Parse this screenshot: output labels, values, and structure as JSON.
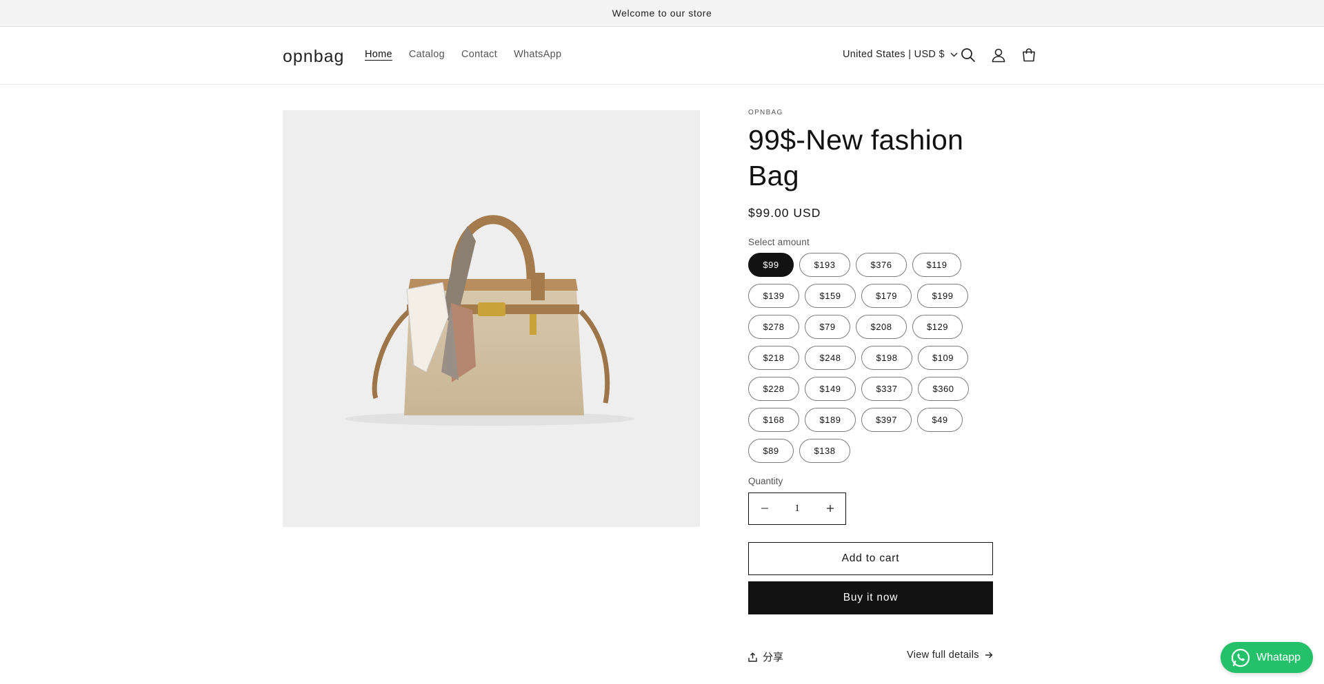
{
  "announcement": "Welcome to our store",
  "header": {
    "logo": "opnbag",
    "nav": [
      "Home",
      "Catalog",
      "Contact",
      "WhatsApp"
    ],
    "locale": "United States | USD $"
  },
  "product": {
    "vendor": "OPNBAG",
    "title": "99$-New fashion Bag",
    "price": "$99.00 USD",
    "select_label": "Select amount",
    "amounts": [
      "$99",
      "$193",
      "$376",
      "$119",
      "$139",
      "$159",
      "$179",
      "$199",
      "$278",
      "$79",
      "$208",
      "$129",
      "$218",
      "$248",
      "$198",
      "$109",
      "$228",
      "$149",
      "$337",
      "$360",
      "$168",
      "$189",
      "$397",
      "$49",
      "$89",
      "$138"
    ],
    "selected_amount": "$99",
    "quantity_label": "Quantity",
    "quantity": "1",
    "add_to_cart": "Add to cart",
    "buy_now": "Buy it now",
    "share": "分享",
    "view_details": "View full details"
  },
  "whatsapp_chat": "Whatapp",
  "colors": {
    "accent": "#121212",
    "whatsapp": "#25c06a",
    "image_bg": "#eeeeee"
  }
}
